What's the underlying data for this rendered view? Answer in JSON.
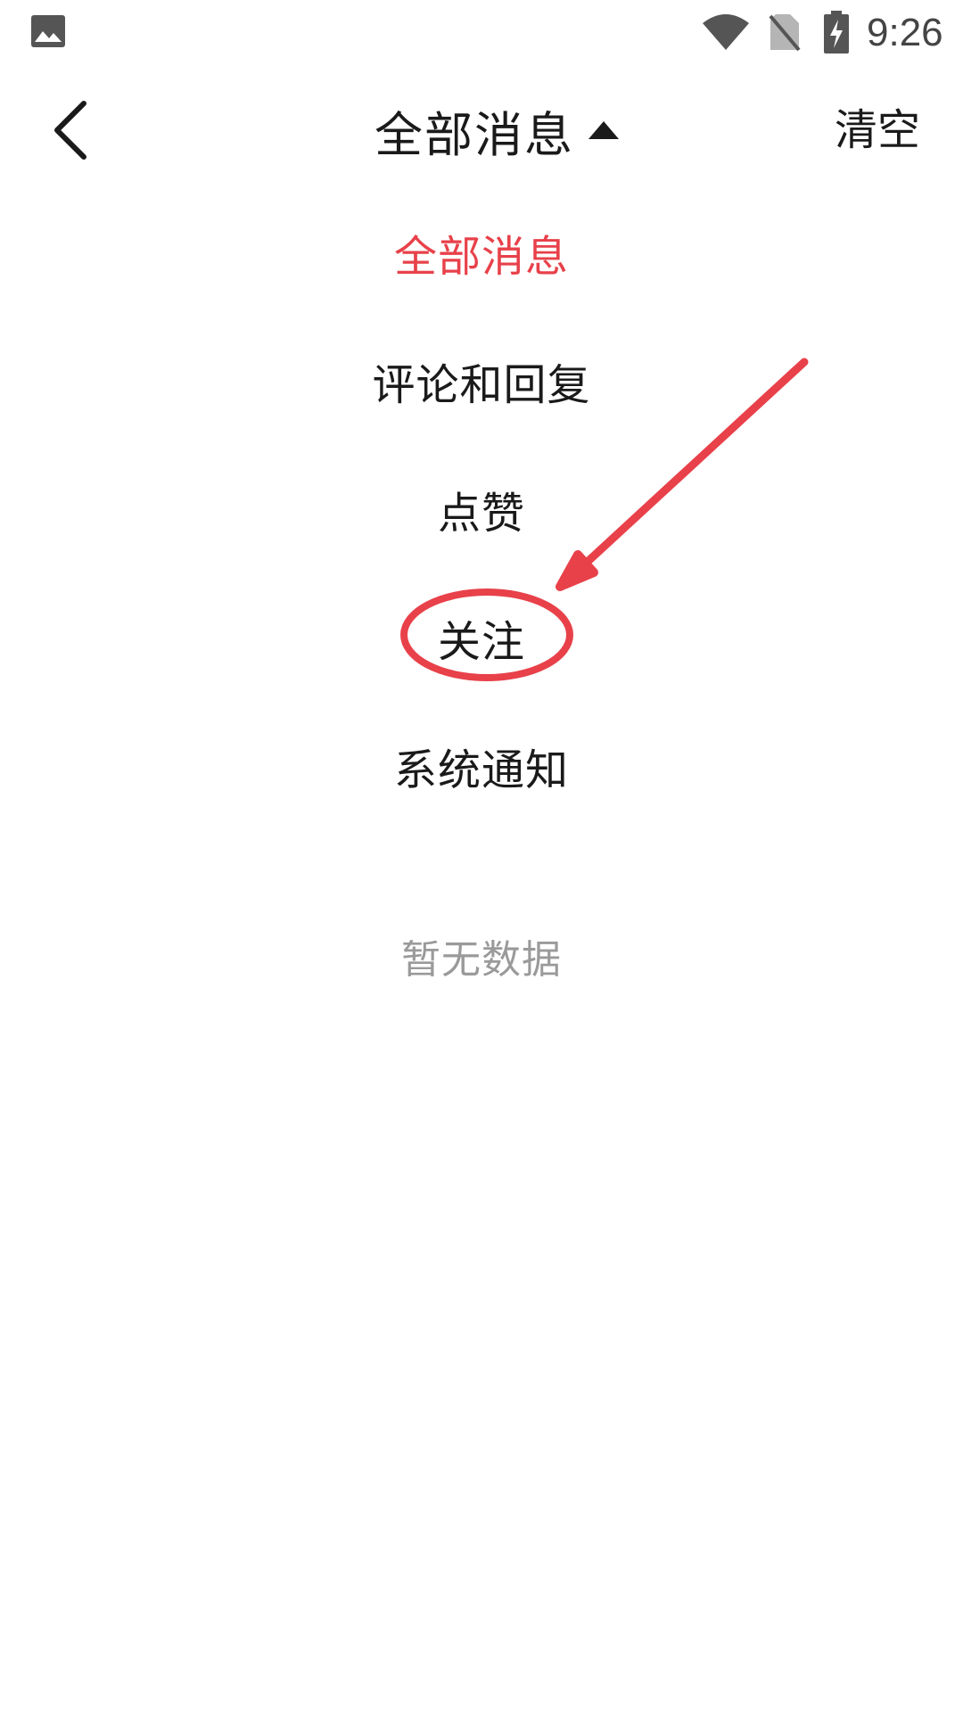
{
  "status_bar": {
    "time": "9:26",
    "icons": [
      "gallery-icon",
      "wifi-icon",
      "no-sim-icon",
      "battery-charging-icon"
    ]
  },
  "nav": {
    "back_icon": "chevron-left-icon",
    "title": "全部消息",
    "title_icon": "caret-up-icon",
    "clear_label": "清空"
  },
  "menu": {
    "items": [
      {
        "label": "全部消息",
        "active": true
      },
      {
        "label": "评论和回复",
        "active": false
      },
      {
        "label": "点赞",
        "active": false
      },
      {
        "label": "关注",
        "active": false
      },
      {
        "label": "系统通知",
        "active": false
      }
    ]
  },
  "empty_state": {
    "text": "暂无数据"
  },
  "annotation": {
    "color": "#e8414a",
    "highlighted_item": "关注"
  },
  "colors": {
    "accent": "#e8414a",
    "text_primary": "#1a1a1a",
    "text_muted": "#9a9a9a"
  }
}
